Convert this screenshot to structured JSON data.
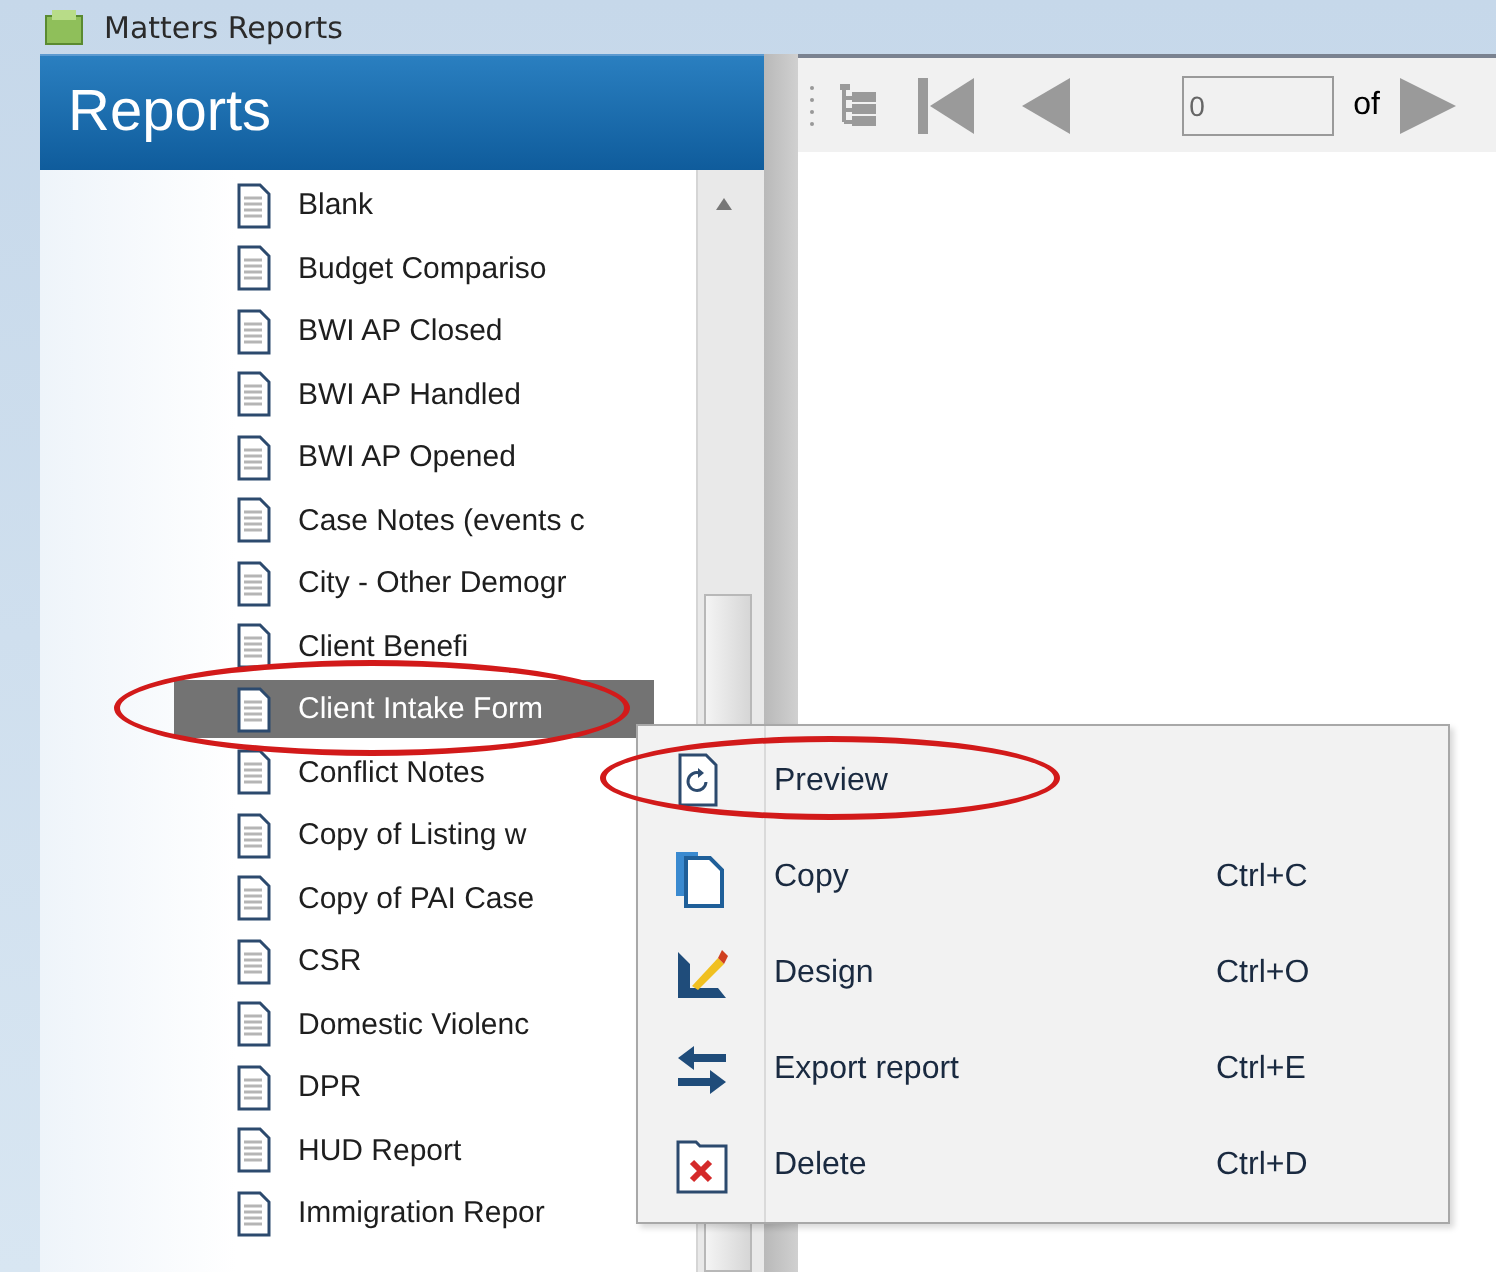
{
  "window": {
    "title": "Matters Reports"
  },
  "panel": {
    "title": "Reports",
    "items": [
      {
        "label": "Blank",
        "selected": false,
        "circled": false
      },
      {
        "label": "Budget Compariso",
        "selected": false,
        "circled": false
      },
      {
        "label": "BWI AP Closed",
        "selected": false,
        "circled": false
      },
      {
        "label": "BWI AP Handled",
        "selected": false,
        "circled": false
      },
      {
        "label": "BWI AP Opened",
        "selected": false,
        "circled": false
      },
      {
        "label": "Case Notes (events c",
        "selected": false,
        "circled": false
      },
      {
        "label": "City - Other Demogr",
        "selected": false,
        "circled": false
      },
      {
        "label": "Client Benefi",
        "selected": false,
        "circled": false
      },
      {
        "label": "Client Intake Form",
        "selected": true,
        "circled": true
      },
      {
        "label": "Conflict Notes",
        "selected": false,
        "circled": false
      },
      {
        "label": "Copy of Listing w",
        "selected": false,
        "circled": false
      },
      {
        "label": "Copy of PAI Case",
        "selected": false,
        "circled": false
      },
      {
        "label": "CSR",
        "selected": false,
        "circled": false
      },
      {
        "label": "Domestic Violenc",
        "selected": false,
        "circled": false
      },
      {
        "label": "DPR",
        "selected": false,
        "circled": false
      },
      {
        "label": "HUD Report",
        "selected": false,
        "circled": false
      },
      {
        "label": "Immigration Repor",
        "selected": false,
        "circled": false
      }
    ]
  },
  "toolbar": {
    "page": {
      "value": "0"
    },
    "of_label": "of"
  },
  "context_menu": {
    "items": [
      {
        "kind": "preview",
        "label": "Preview",
        "circled": true
      },
      {
        "kind": "copy",
        "label": "Copy",
        "shortcut": "Ctrl+C",
        "circled": false
      },
      {
        "kind": "design",
        "label": "Design",
        "shortcut": "Ctrl+O",
        "circled": false
      },
      {
        "kind": "export",
        "label": "Export report",
        "shortcut": "Ctrl+E",
        "circled": false
      },
      {
        "kind": "delete",
        "label": "Delete",
        "shortcut": "Ctrl+D",
        "circled": false
      }
    ]
  }
}
